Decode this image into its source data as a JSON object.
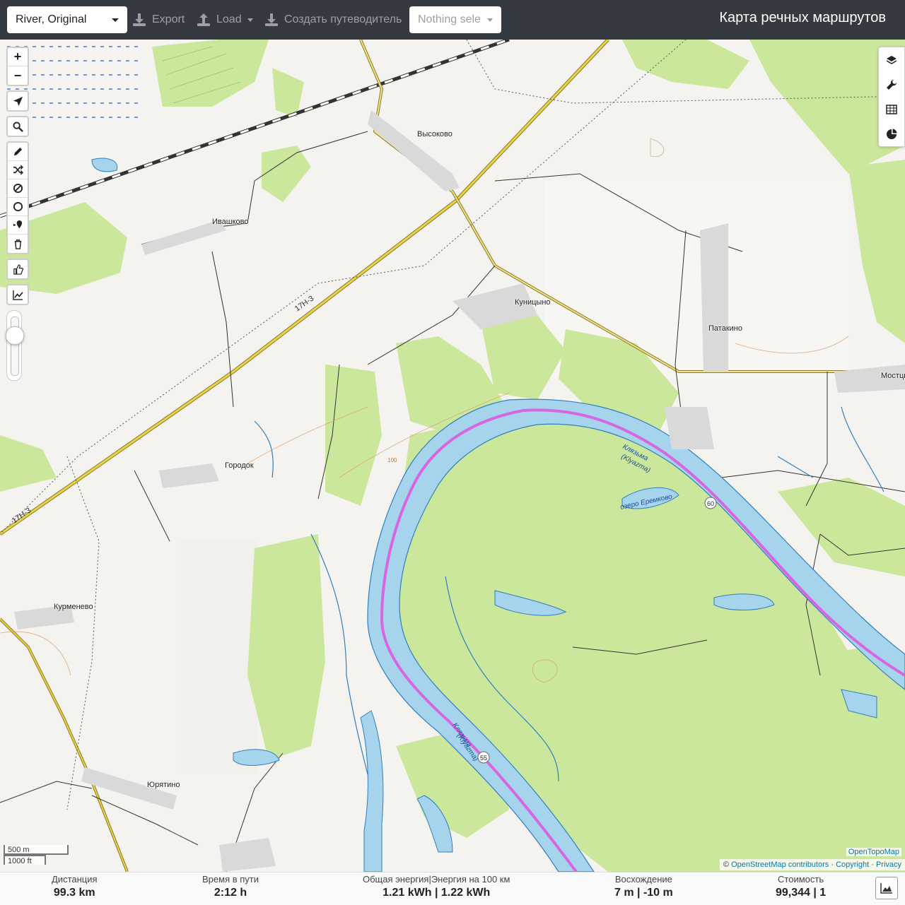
{
  "navbar": {
    "profile": "River, Original",
    "export_label": "Export",
    "load_label": "Load",
    "guide_label": "Создать путеводитель",
    "track_placeholder": "Nothing selected",
    "track_visible": "Nothing sele",
    "brand": "Карта речных маршрутов"
  },
  "map": {
    "places": {
      "vysokovo": "Высоково",
      "ivashkovo": "Ивашково",
      "kunitsyno": "Куницыно",
      "patakino": "Патакино",
      "mostsy": "Мостцы",
      "gorodok": "Городок",
      "kurmenevo": "Курменево",
      "yuryatino": "Юрятино"
    },
    "road_label_1": "17Н-3",
    "road_label_2": "17Н-3",
    "river_label_1": "Клязьма",
    "river_label_1b": "(Klyazma)",
    "river_label_2": "Клязьма",
    "river_label_2b": "(Klyazma)",
    "lake_label": "озеро Еремково",
    "km_markers": [
      "60",
      "55"
    ],
    "contour_label": "100"
  },
  "scale": {
    "metric": "500 m",
    "imperial": "1000 ft"
  },
  "attribution": {
    "opentopomap": "OpenTopoMap",
    "copyright_symbol": "©",
    "osm": "OpenStreetMap contributors",
    "copyright": "Copyright",
    "privacy": "Privacy",
    "separator": "·"
  },
  "stats": {
    "distance_label": "Дистанция",
    "distance_value": "99.3 km",
    "time_label": "Время в пути",
    "time_value": "2:12 h",
    "energy_label": "Общая энергия|Энергия на 100 км",
    "energy_value": "1.21 kWh | 1.22 kWh",
    "ascent_label": "Восхождение",
    "ascent_value": "7 m | -10 m",
    "cost_label": "Стоимость",
    "cost_value": "99,344 | 1"
  },
  "icons": {
    "zoom_in": "+",
    "zoom_out": "−"
  },
  "colors": {
    "navbar": "#343a40",
    "river": "#a6d4ec",
    "route": "#d866e0",
    "forest": "#cbe79b",
    "road": "#e8d24a"
  }
}
